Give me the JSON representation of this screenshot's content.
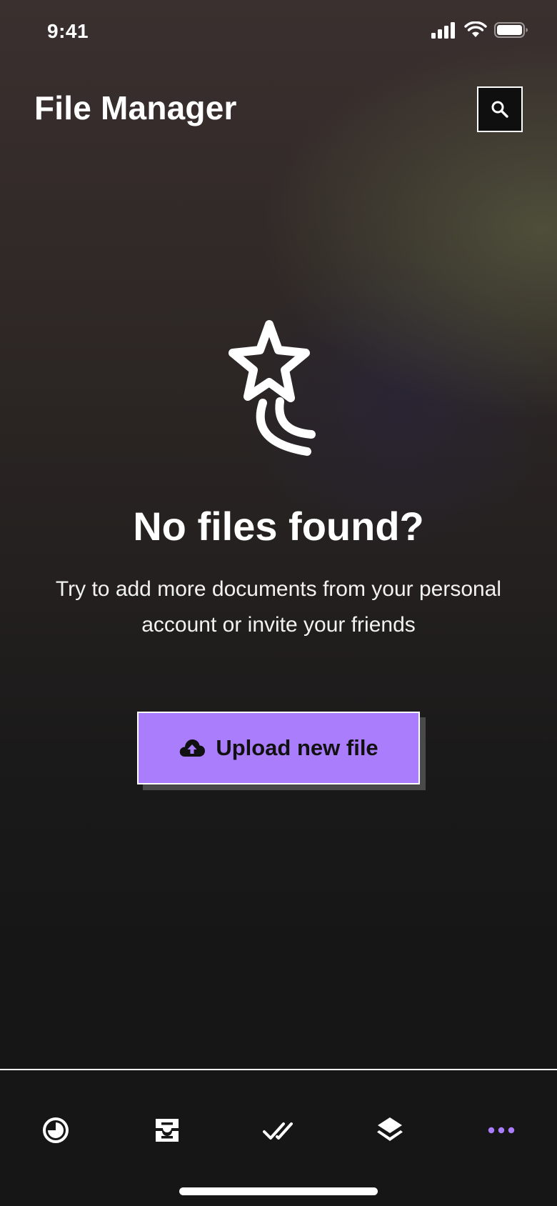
{
  "status_bar": {
    "time": "9:41"
  },
  "header": {
    "title": "File Manager",
    "search_icon": "search-icon"
  },
  "empty_state": {
    "illustration_icon": "shooting-star-icon",
    "title": "No files found?",
    "description_line1": "Try to add more documents from your personal",
    "description_line2": "account or invite your friends"
  },
  "upload_button": {
    "icon": "cloud-upload-icon",
    "label": "Upload new file",
    "color": "#a97dfb"
  },
  "bottom_nav": {
    "items": [
      {
        "icon": "clock-pie-icon",
        "active": false
      },
      {
        "icon": "inbox-tray-icon",
        "active": false
      },
      {
        "icon": "double-check-icon",
        "active": false
      },
      {
        "icon": "layers-icon",
        "active": false
      },
      {
        "icon": "more-dots-icon",
        "active": true
      }
    ],
    "active_color": "#a97dfb"
  }
}
